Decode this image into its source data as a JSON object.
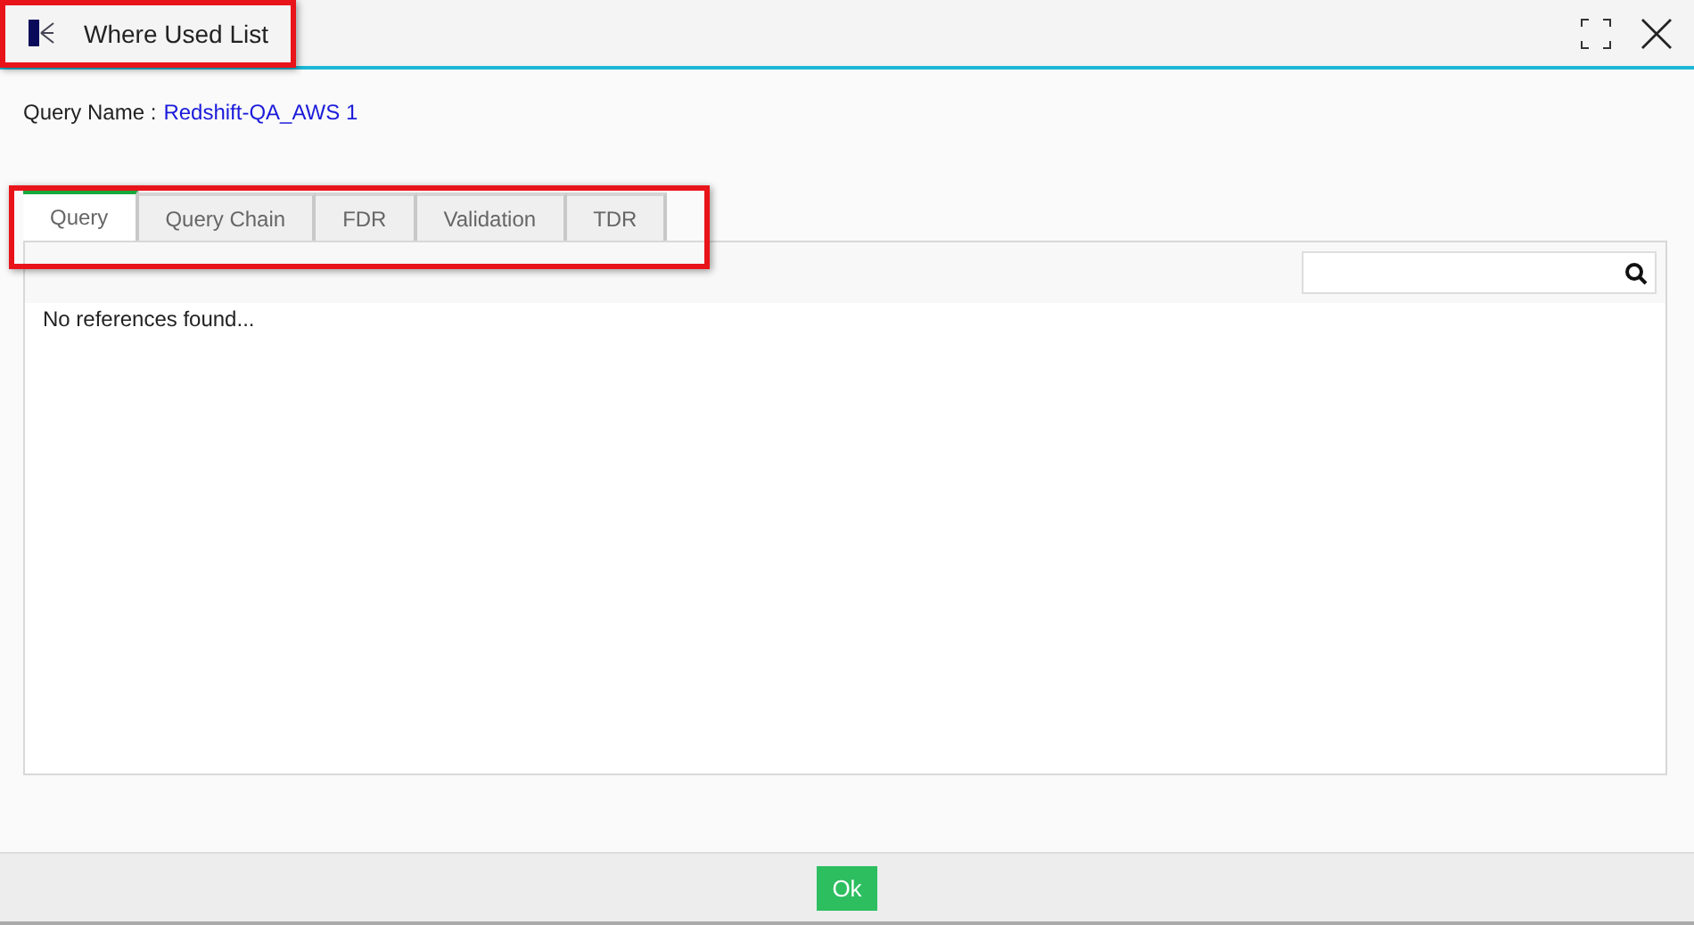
{
  "window": {
    "title": "Where Used List"
  },
  "query_name": {
    "label": "Query Name :",
    "value": "Redshift-QA_AWS 1"
  },
  "tabs": [
    {
      "label": "Query",
      "selected": true
    },
    {
      "label": "Query Chain",
      "selected": false
    },
    {
      "label": "FDR",
      "selected": false
    },
    {
      "label": "Validation",
      "selected": false
    },
    {
      "label": "TDR",
      "selected": false
    }
  ],
  "message": "No references found...",
  "buttons": [
    "Ok"
  ]
}
